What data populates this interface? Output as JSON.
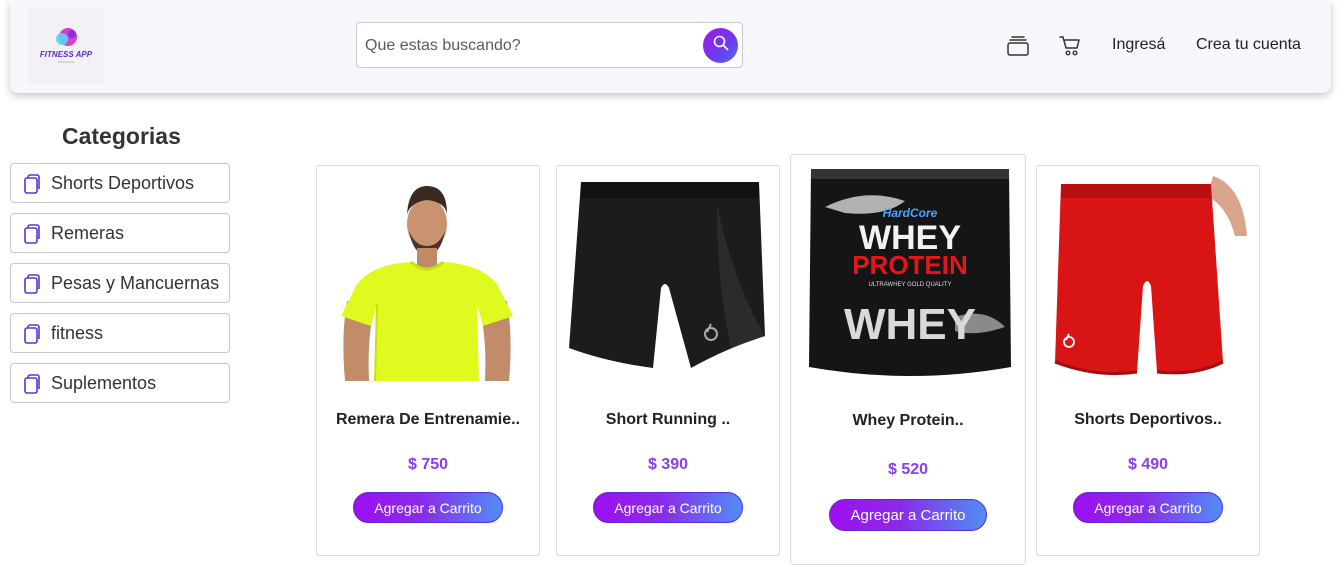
{
  "header": {
    "logo_text": "FITNESS APP",
    "search_placeholder": "Que estas buscando?",
    "login_label": "Ingresá",
    "signup_label": "Crea tu cuenta"
  },
  "sidebar": {
    "title": "Categorias",
    "items": [
      {
        "label": "Shorts Deportivos"
      },
      {
        "label": "Remeras"
      },
      {
        "label": "Pesas y Mancuernas"
      },
      {
        "label": "fitness"
      },
      {
        "label": "Suplementos"
      }
    ]
  },
  "products": [
    {
      "name": "Remera De Entrenamie..",
      "price": "$ 750",
      "button": "Agregar a Carrito"
    },
    {
      "name": "Short Running ..",
      "price": "$ 390",
      "button": "Agregar a Carrito"
    },
    {
      "name": "Whey Protein..",
      "price": "$ 520",
      "button": "Agregar a Carrito",
      "image_text": {
        "brand": "HardCore",
        "line1": "WHEY",
        "line2": "PROTEIN",
        "tagline": "ULTRAWHEY GOLD QUALITY",
        "line3": "WHEY"
      }
    },
    {
      "name": "Shorts Deportivos..",
      "price": "$ 490",
      "button": "Agregar a Carrito"
    }
  ],
  "colors": {
    "accent_purple": "#8a3ee8",
    "gradient_start": "#9d0ff0",
    "gradient_end": "#4f8ef5",
    "category_icon": "#5b34d6"
  },
  "icons": {
    "search": "search-icon",
    "orders": "stack-icon",
    "cart": "cart-icon",
    "category": "copy-icon"
  }
}
